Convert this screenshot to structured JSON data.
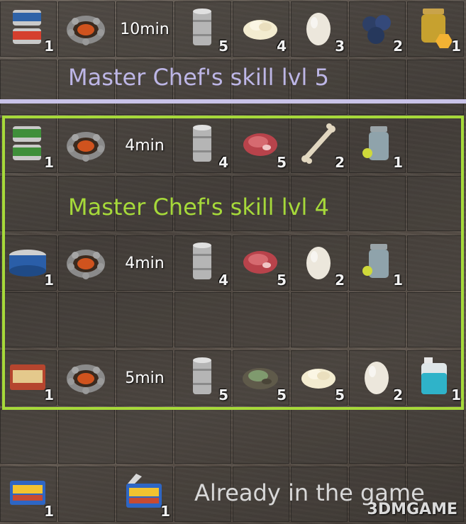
{
  "tiers": {
    "lvl5_label": "Master Chef's skill lvl 5",
    "lvl4_label": "Master Chef's skill lvl 4",
    "existing_label": "Already in the game"
  },
  "recipes": [
    {
      "name": "recipe-row-1",
      "time": "10min",
      "items": [
        {
          "icon": "canned-goods-stack-icon",
          "count": "1"
        },
        {
          "icon": "campfire-icon",
          "count": ""
        },
        {
          "icon": "empty-can-icon",
          "count": "5"
        },
        {
          "icon": "mashed-potato-icon",
          "count": "4"
        },
        {
          "icon": "egg-icon",
          "count": "3"
        },
        {
          "icon": "blueberries-icon",
          "count": "2"
        },
        {
          "icon": "honey-jar-icon",
          "count": "1"
        }
      ]
    },
    {
      "name": "recipe-row-2",
      "time": "4min",
      "items": [
        {
          "icon": "meow-chow-can-icon",
          "count": "1"
        },
        {
          "icon": "campfire-icon",
          "count": ""
        },
        {
          "icon": "empty-can-icon",
          "count": "4"
        },
        {
          "icon": "raw-meat-icon",
          "count": "5"
        },
        {
          "icon": "bone-icon",
          "count": "2"
        },
        {
          "icon": "water-jar-icon",
          "count": "1"
        }
      ]
    },
    {
      "name": "recipe-row-3",
      "time": "4min",
      "items": [
        {
          "icon": "tuna-can-icon",
          "count": "1"
        },
        {
          "icon": "campfire-icon",
          "count": ""
        },
        {
          "icon": "empty-can-icon",
          "count": "4"
        },
        {
          "icon": "raw-meat-icon",
          "count": "5"
        },
        {
          "icon": "egg-icon",
          "count": "2"
        },
        {
          "icon": "water-jar-icon",
          "count": "1"
        }
      ]
    },
    {
      "name": "recipe-row-4",
      "time": "5min",
      "items": [
        {
          "icon": "salmon-can-icon",
          "count": "1"
        },
        {
          "icon": "campfire-icon",
          "count": ""
        },
        {
          "icon": "empty-can-icon",
          "count": "5"
        },
        {
          "icon": "fish-steak-icon",
          "count": "5"
        },
        {
          "icon": "mashed-potato-icon",
          "count": "5"
        },
        {
          "icon": "egg-icon",
          "count": "2"
        },
        {
          "icon": "antifreeze-jug-icon",
          "count": "1"
        }
      ]
    }
  ],
  "existing_items": [
    {
      "icon": "sham-can-icon",
      "count": "1"
    },
    {
      "icon": "sham-can-open-icon",
      "count": "1"
    }
  ],
  "watermark": "3DMGAME",
  "colors": {
    "lvl5": "#bdb6e6",
    "lvl4": "#a6d93a"
  }
}
